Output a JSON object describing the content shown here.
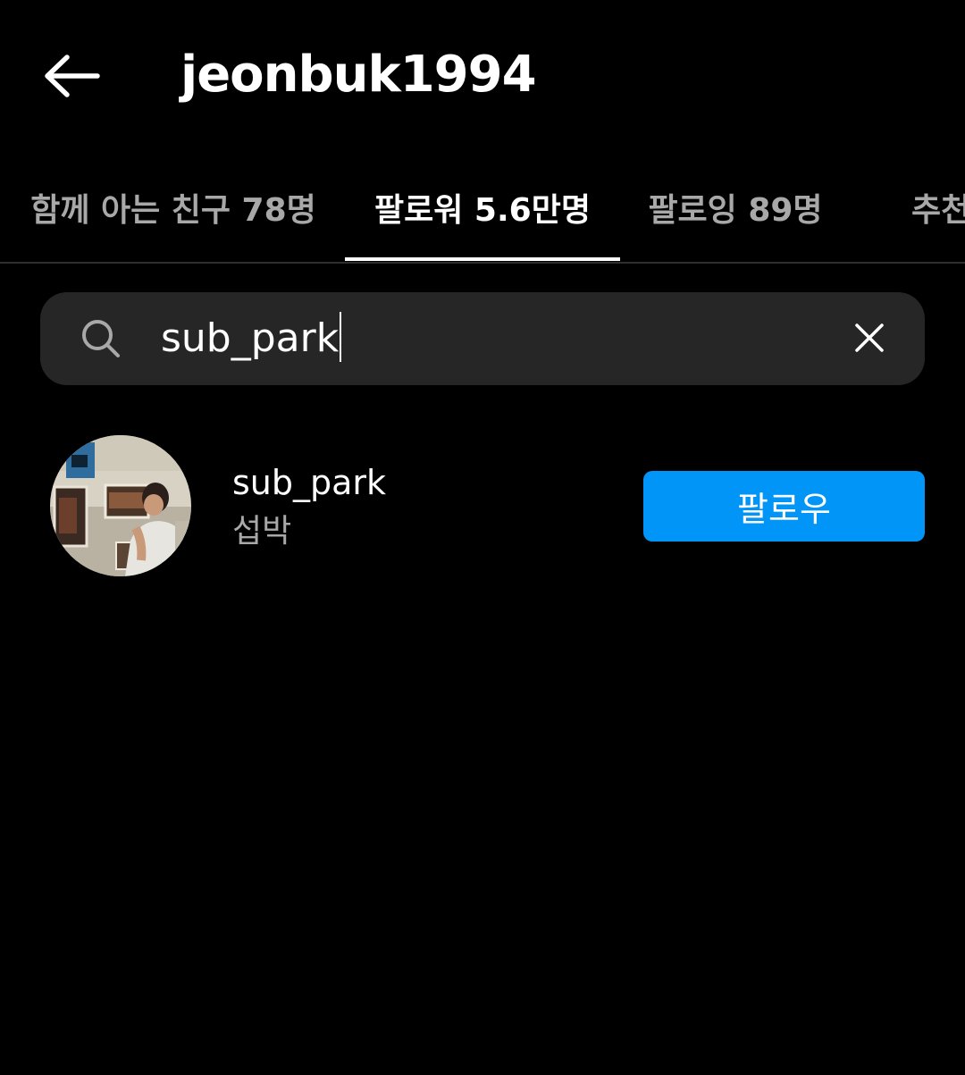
{
  "header": {
    "title": "jeonbuk1994",
    "back_icon": "arrow-left-icon"
  },
  "tabs": [
    {
      "label": "함께 아는 친구 78명",
      "active": false
    },
    {
      "label": "팔로워 5.6만명",
      "active": true
    },
    {
      "label": "팔로잉 89명",
      "active": false
    },
    {
      "label": "추천",
      "active": false
    }
  ],
  "search": {
    "icon": "search-icon",
    "value": "sub_park",
    "clear_icon": "close-icon"
  },
  "results": [
    {
      "username": "sub_park",
      "full_name": "섭박",
      "avatar": "avatar-photo",
      "follow_label": "팔로우"
    }
  ],
  "colors": {
    "background": "#000000",
    "search_bg": "#262626",
    "secondary_text": "#a8a8a8",
    "follow_button": "#0095f6",
    "divider": "#2e2e2e"
  }
}
